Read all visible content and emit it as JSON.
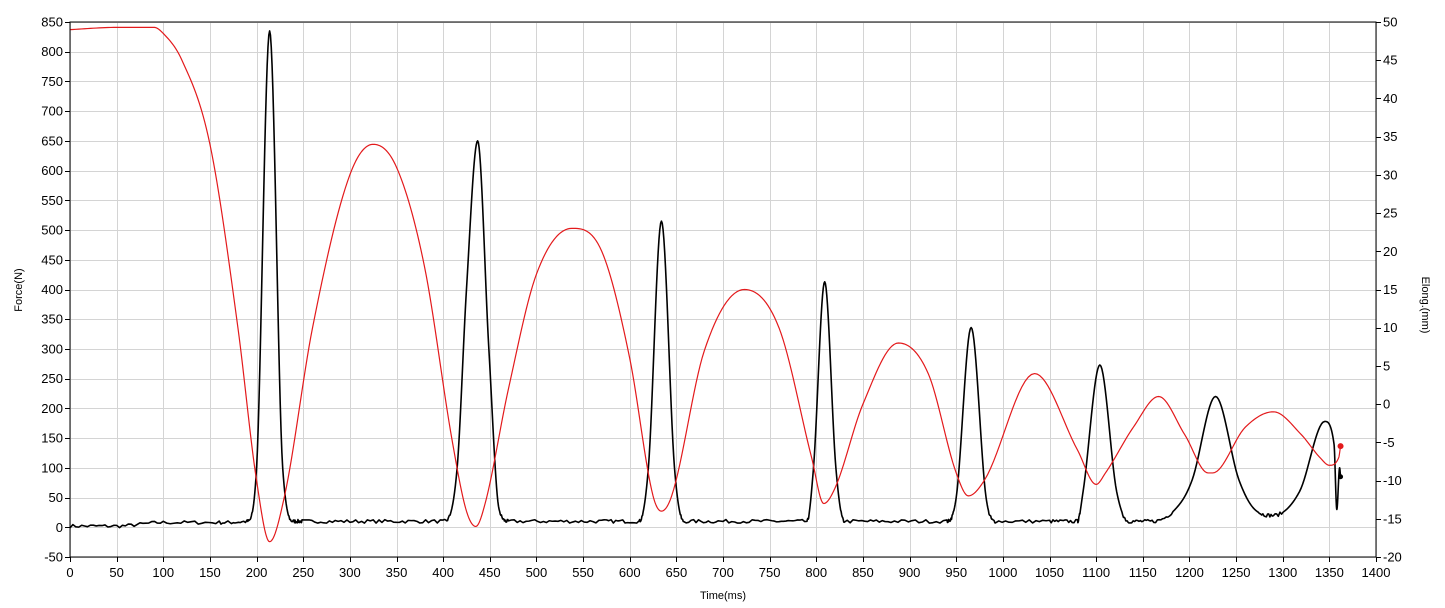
{
  "chart_data": {
    "type": "line",
    "title": "",
    "xlabel": "Time(ms)",
    "ylabel": "Force(N)",
    "y2label": "Elong.(mm)",
    "xlim": [
      0,
      1400
    ],
    "ylim": [
      -50,
      850
    ],
    "y2lim": [
      -20,
      50
    ],
    "x_ticks": [
      0,
      50,
      100,
      150,
      200,
      250,
      300,
      350,
      400,
      450,
      500,
      550,
      600,
      650,
      700,
      750,
      800,
      850,
      900,
      950,
      1000,
      1050,
      1100,
      1150,
      1200,
      1250,
      1300,
      1350,
      1400
    ],
    "y_ticks": [
      -50,
      0,
      50,
      100,
      150,
      200,
      250,
      300,
      350,
      400,
      450,
      500,
      550,
      600,
      650,
      700,
      750,
      800,
      850
    ],
    "y2_ticks": [
      -20,
      -15,
      -10,
      -5,
      0,
      5,
      10,
      15,
      20,
      25,
      30,
      35,
      40,
      45,
      50
    ],
    "grid": true,
    "series": [
      {
        "axis": "left",
        "color": "#000000",
        "x": [
          0,
          50,
          100,
          160,
          190,
          200,
          214,
          228,
          240,
          250,
          300,
          350,
          400,
          415,
          425,
          437,
          449,
          460,
          470,
          520,
          570,
          610,
          620,
          634,
          648,
          658,
          700,
          750,
          790,
          797,
          809,
          821,
          830,
          880,
          940,
          950,
          966,
          982,
          992,
          1050,
          1080,
          1086,
          1104,
          1122,
          1135,
          1160,
          1190,
          1203,
          1228,
          1253,
          1270,
          1290,
          1318,
          1345,
          1355,
          1358,
          1361,
          1362
        ],
        "y": [
          2,
          2,
          8,
          8,
          10,
          100,
          835,
          100,
          10,
          10,
          10,
          10,
          10,
          100,
          400,
          650,
          300,
          30,
          10,
          10,
          10,
          10,
          100,
          515,
          100,
          10,
          10,
          10,
          10,
          100,
          413,
          100,
          10,
          10,
          10,
          50,
          336,
          50,
          10,
          10,
          10,
          60,
          273,
          60,
          10,
          10,
          40,
          80,
          220,
          80,
          30,
          20,
          60,
          178,
          140,
          30,
          100,
          85
        ]
      },
      {
        "axis": "right",
        "color": "#e31a1c",
        "x": [
          0,
          50,
          90,
          100,
          120,
          150,
          180,
          200,
          214,
          230,
          260,
          300,
          325,
          350,
          380,
          410,
          425,
          435,
          445,
          470,
          500,
          538,
          570,
          600,
          625,
          634,
          645,
          680,
          723,
          760,
          795,
          808,
          820,
          850,
          888,
          920,
          950,
          963,
          980,
          1034,
          1080,
          1100,
          1110,
          1140,
          1167,
          1195,
          1220,
          1225,
          1260,
          1290,
          1320,
          1340,
          1350,
          1360,
          1362
        ],
        "y": [
          49,
          49.3,
          49.3,
          48.5,
          45,
          34,
          10,
          -10,
          -18,
          -12,
          10,
          30,
          34,
          31,
          18,
          -5,
          -14,
          -16,
          -13,
          2,
          17,
          23,
          20,
          6,
          -12,
          -14,
          -12,
          7,
          15,
          10,
          -7,
          -13,
          -11,
          0,
          8,
          4,
          -9,
          -12,
          -10,
          4,
          -6,
          -10.5,
          -9,
          -3,
          1,
          -4,
          -9,
          -9,
          -3,
          -1,
          -4,
          -7,
          -8,
          -7,
          -5.5
        ]
      }
    ]
  }
}
